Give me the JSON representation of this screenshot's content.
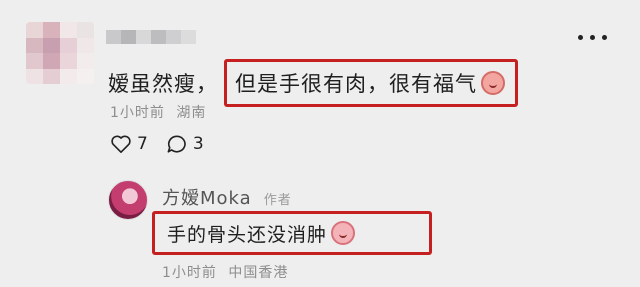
{
  "comment": {
    "username": "",
    "text_plain": "嫒虽然瘦，",
    "text_highlighted": "但是手很有肉，很有福气",
    "time": "1小时前",
    "location": "湖南",
    "like_count": "7",
    "reply_count": "3",
    "emoji": "happy-face-emoji"
  },
  "reply": {
    "username": "方嫒Moka",
    "author_tag": "作者",
    "text": "手的骨头还没消肿",
    "time": "1小时前",
    "location": "中国香港",
    "emoji": "crying-face-emoji"
  },
  "colors": {
    "background": "#eeeeef",
    "highlight_border": "#c51f1f",
    "meta_text": "#8e8e8e"
  }
}
